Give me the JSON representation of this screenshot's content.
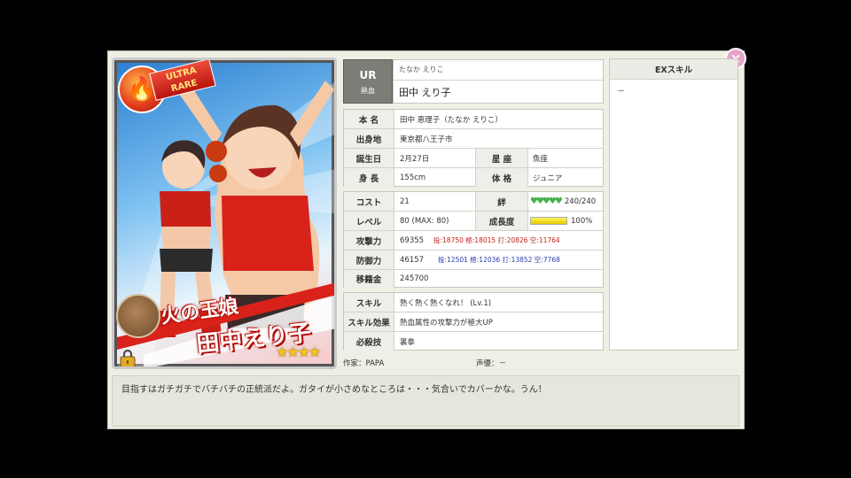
{
  "card": {
    "badge_label": "ULTRA RARE",
    "name_line1": "火の玉娘",
    "name_line2": "田中えり子",
    "stars": "★★★★",
    "attribute_icon": "fire-icon"
  },
  "profile": {
    "rarity": "UR",
    "attribute": "熱血",
    "reading": "たなか えりこ",
    "name": "田中 えり子",
    "real_name_label": "本 名",
    "real_name": "田中 恵理子（たなか えりこ）",
    "birthplace_label": "出身地",
    "birthplace": "東京都八王子市",
    "birthday_label": "誕生日",
    "birthday": "2月27日",
    "sign_label": "星 座",
    "sign": "魚座",
    "height_label": "身 長",
    "height": "155cm",
    "body_label": "体 格",
    "body": "ジュニア"
  },
  "stats": {
    "cost_label": "コスト",
    "cost": "21",
    "bond_label": "絆",
    "bond": "240/240",
    "bond_fraction": 1.0,
    "level_label": "レベル",
    "level": "80 (MAX: 80)",
    "growth_label": "成長度",
    "growth": "100%",
    "growth_fraction": 1.0,
    "attack_label": "攻撃力",
    "attack": "69355",
    "attack_breakdown": "投:18750 極:18015 打:20826 空:11764",
    "defense_label": "防御力",
    "defense": "46157",
    "defense_breakdown": "投:12501 極:12036 打:13852 空:7768",
    "transfer_label": "移籍金",
    "transfer": "245700"
  },
  "skill": {
    "skill_label": "スキル",
    "skill": "熱く熱く熱くなれ！ (Lv.1)",
    "effect_label": "スキル効果",
    "effect": "熱血属性の攻撃力が極大UP",
    "move_label": "必殺技",
    "move": "裏拳"
  },
  "exskill": {
    "title": "EXスキル",
    "value": "－"
  },
  "credits": {
    "artist": "作家：PAPA",
    "voice": "声優：－"
  },
  "quote": "目指すはガチガチでバチバチの正統派だよ。ガタイが小さめなところは・・・気合いでカバーかな。うん！",
  "close_label": "×"
}
